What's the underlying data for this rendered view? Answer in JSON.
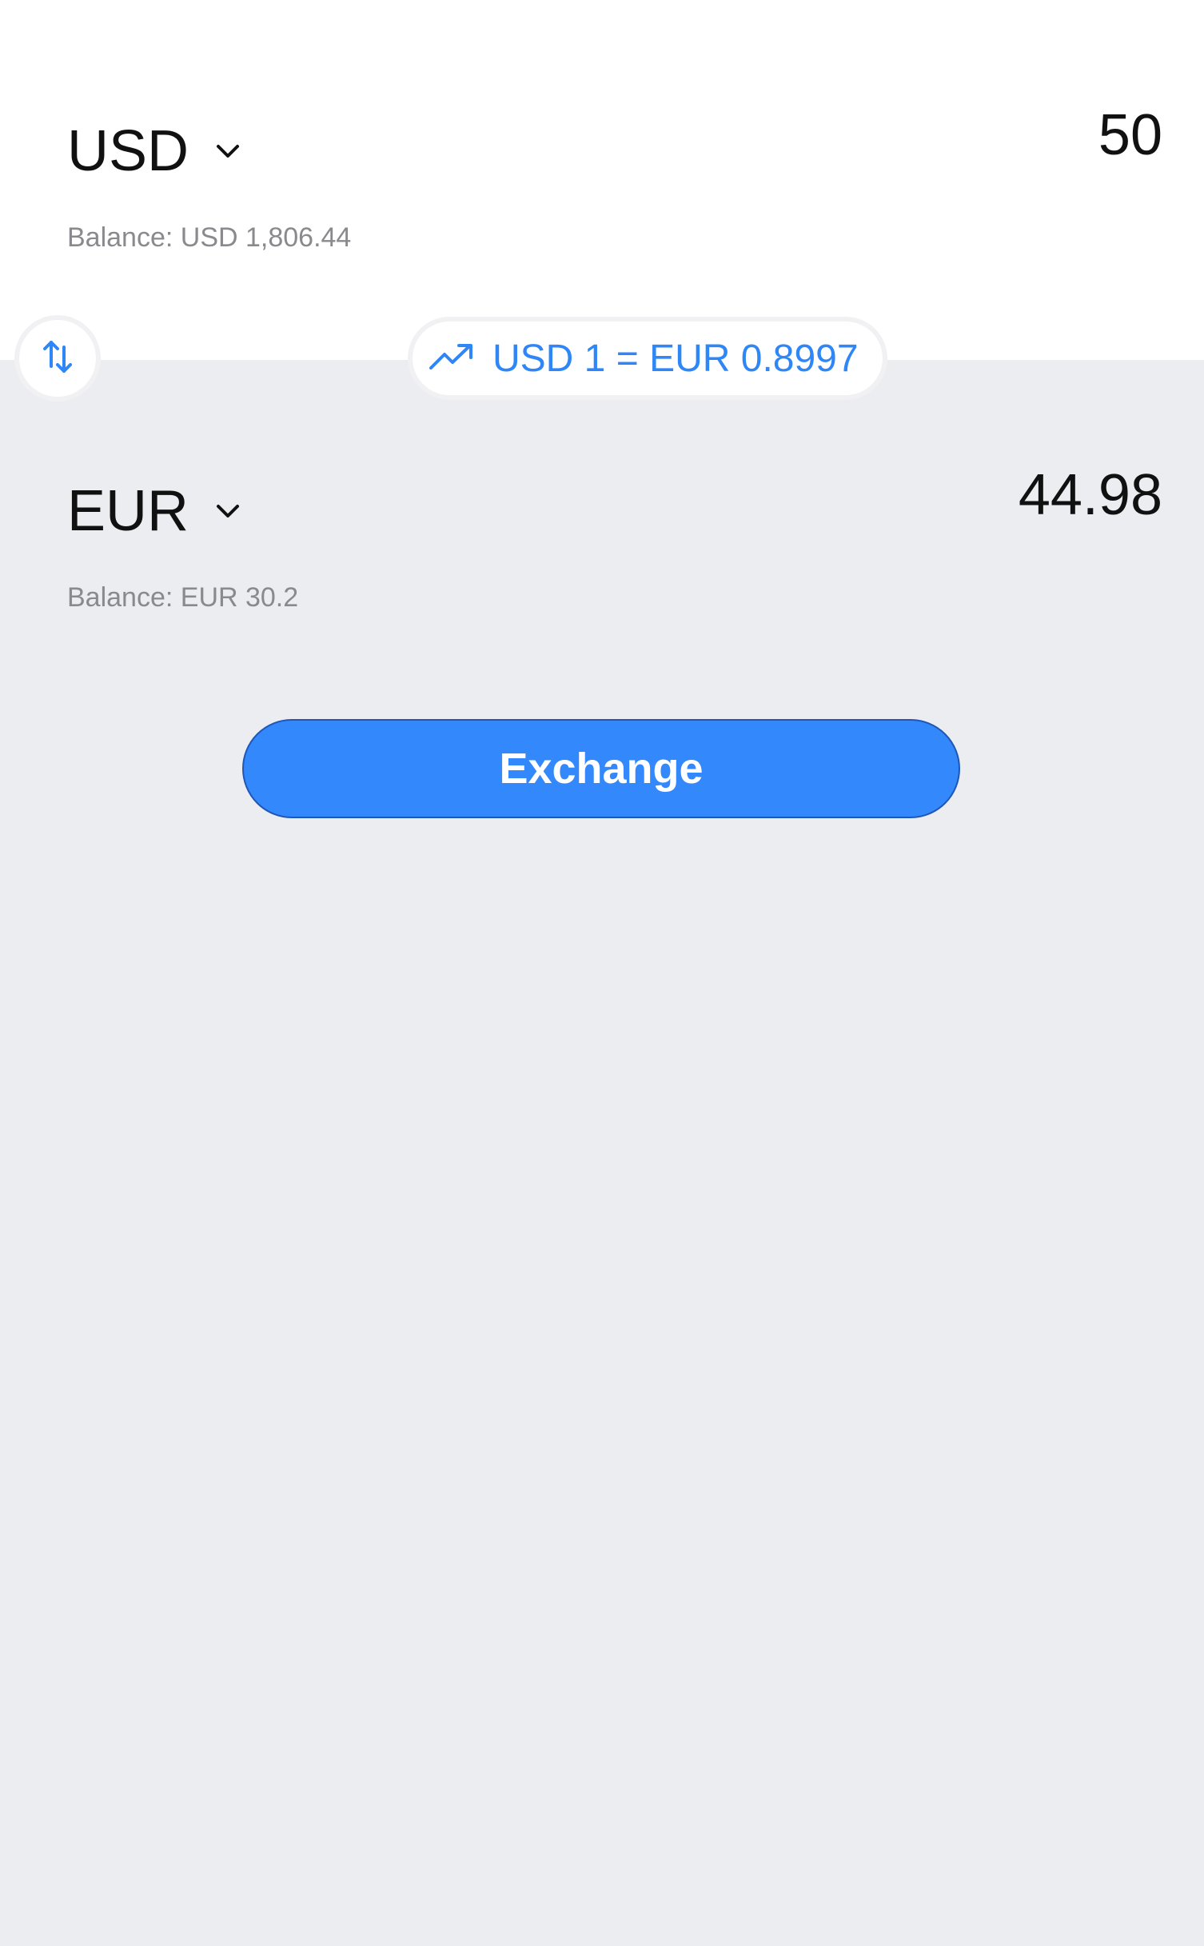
{
  "from": {
    "currency": "USD",
    "amount": "50",
    "balance": "Balance: USD 1,806.44"
  },
  "to": {
    "currency": "EUR",
    "amount": "44.98",
    "balance": "Balance: EUR 30.2"
  },
  "rate": {
    "text": "USD 1 = EUR 0.8997"
  },
  "actions": {
    "exchange_label": "Exchange"
  },
  "icons": {
    "swap": "swap-vertical-arrows-icon",
    "rate": "trending-up-icon",
    "dropdown": "chevron-down-icon"
  },
  "colors": {
    "accent": "#2F86F6",
    "button": "#3388FC",
    "panel_bg": "#FFFFFF",
    "page_bg": "#ECEDF1",
    "balance_text": "#8A8A8E"
  }
}
